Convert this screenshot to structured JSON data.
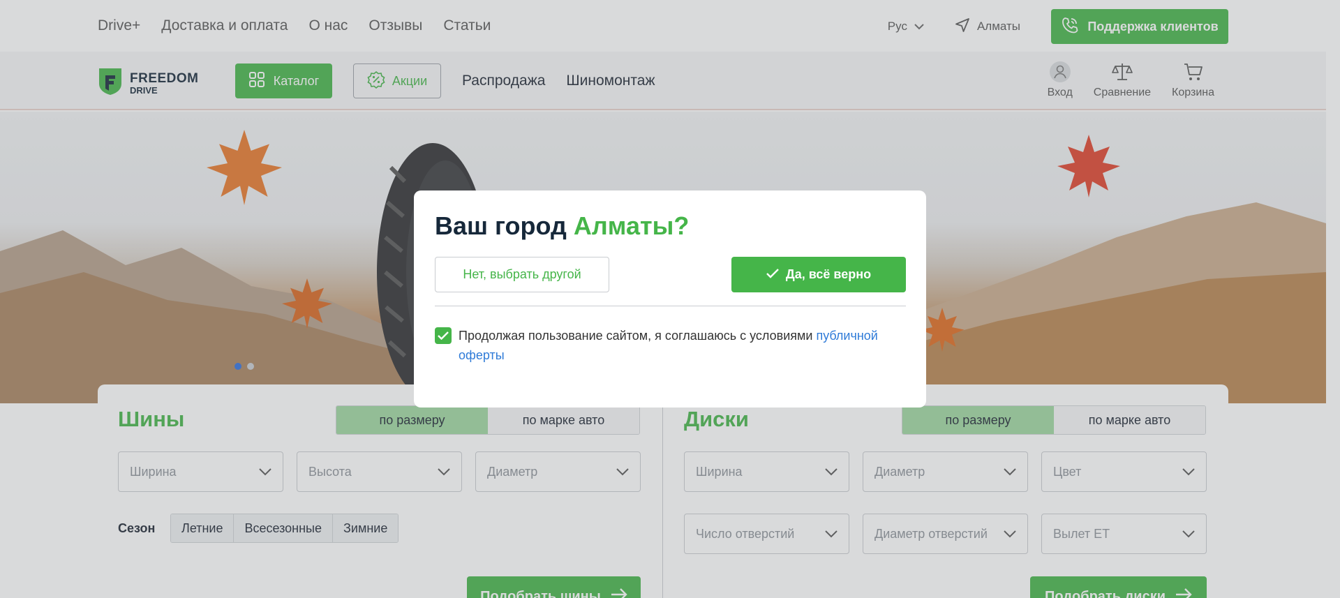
{
  "topbar": {
    "nav": [
      "Drive+",
      "Доставка и оплата",
      "О нас",
      "Отзывы",
      "Статьи"
    ],
    "language": "Рус",
    "city": "Алматы",
    "support_button": "Поддержка клиентов"
  },
  "header": {
    "logo_line1": "FREEDOM",
    "logo_line2": "DRIVE",
    "catalog_button": "Каталог",
    "promo_button": "Акции",
    "nav": [
      "Распродажа",
      "Шиномонтаж"
    ],
    "login": "Вход",
    "compare": "Сравнение",
    "cart": "Корзина"
  },
  "hero": {
    "slides_total": 2,
    "active_slide": 1
  },
  "tires": {
    "title": "Шины",
    "tabs": [
      "по размеру",
      "по марке авто"
    ],
    "active_tab": 0,
    "selects": [
      "Ширина",
      "Высота",
      "Диаметр"
    ],
    "season_label": "Сезон",
    "seasons": [
      "Летние",
      "Всесезонные",
      "Зимние"
    ],
    "submit": "Подобрать шины"
  },
  "wheels": {
    "title": "Диски",
    "tabs": [
      "по размеру",
      "по марке авто"
    ],
    "active_tab": 0,
    "selects_row1": [
      "Ширина",
      "Диаметр",
      "Цвет"
    ],
    "selects_row2": [
      "Число отверстий",
      "Диаметр отверстий",
      "Вылет ET"
    ],
    "submit": "Подобрать диски"
  },
  "modal": {
    "title_prefix": "Ваш город",
    "title_city": "Алматы?",
    "no_button": "Нет, выбрать другой",
    "yes_button": "Да, всё верно",
    "agree_text": "Продолжая пользование сайтом, я соглашаюсь с условиями",
    "agree_link": "публичной оферты",
    "agree_checked": true
  },
  "colors": {
    "brand_green": "#45b549",
    "dark": "#16283a",
    "link_blue": "#2f7bd8"
  }
}
